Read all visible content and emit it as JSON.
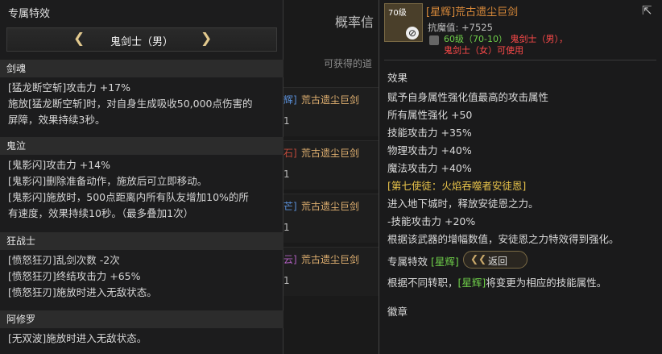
{
  "left": {
    "title": "专属特效",
    "job_name": "鬼剑士（男）",
    "sections": [
      {
        "name": "剑魂",
        "lines": [
          "[猛龙断空斩]攻击力 +17%",
          "施放[猛龙断空斩]时，对自身生成吸收50,000点伤害的",
          "屏障，效果持续3秒。"
        ]
      },
      {
        "name": "鬼泣",
        "lines": [
          "[鬼影闪]攻击力 +14%",
          "[鬼影闪]删除准备动作，施放后可立即移动。",
          "[鬼影闪]施放时，500点距离内所有队友增加10%的所",
          "有速度，效果持续10秒。（最多叠加1次）"
        ]
      },
      {
        "name": "狂战士",
        "lines": [
          "[愤怒狂刃]乱剑次数 -2次",
          "[愤怒狂刃]终结攻击力 +65%",
          "[愤怒狂刃]施放时进入无敌状态。"
        ]
      },
      {
        "name": "阿修罗",
        "lines": [
          "[无双波]施放时进入无敌状态。"
        ]
      }
    ]
  },
  "middle": {
    "title": "概率信",
    "subtitle": "可获得的道",
    "rows": [
      {
        "tag": "辉]",
        "tag_color": "#5a8fd8",
        "name": "荒古遗尘巨剑",
        "count": "1"
      },
      {
        "tag": "石]",
        "tag_color": "#c04a3a",
        "name": "荒古遗尘巨剑",
        "count": "1"
      },
      {
        "tag": "芒]",
        "tag_color": "#5a8fd8",
        "name": "荒古遗尘巨剑",
        "count": "1"
      },
      {
        "tag": "云]",
        "tag_color": "#b060c0",
        "name": "荒古遗尘巨剑",
        "count": "1"
      }
    ]
  },
  "right": {
    "level_badge": "70级",
    "item_name": "[星辉]荒古遗尘巨剑",
    "resist": "抗魔值: +7525",
    "req_level": "60级（70-10）",
    "req_job1": "鬼剑士（男），",
    "req_job2": "鬼剑士（女）可使用",
    "effect_header": "效果",
    "effects": [
      "赋予自身属性强化值最高的攻击属性",
      "所有属性强化 +50",
      "技能攻击力 +35%",
      "物理攻击力 +40%",
      "魔法攻击力 +40%",
      "[第七使徒：火焰吞噬者安徒恩]",
      "进入地下城时，释放安徒恩之力。",
      "-技能攻击力 +20%",
      "根据该武器的增幅数值，安徒恩之力特效得到强化。"
    ],
    "special_label": "专属特效",
    "special_tag": "[星辉]",
    "back_label": "返回",
    "special_desc_pre": "根据不同转职，",
    "special_desc_tag": "[星辉]",
    "special_desc_post": "将变更为相应的技能属性。",
    "badge_header": "徽章"
  },
  "colors": {
    "gold": "#e2c98e",
    "orange": "#d98a3a",
    "red": "#ff4a4a",
    "green": "#6fcf4a",
    "highlight": "#e8c34a"
  }
}
